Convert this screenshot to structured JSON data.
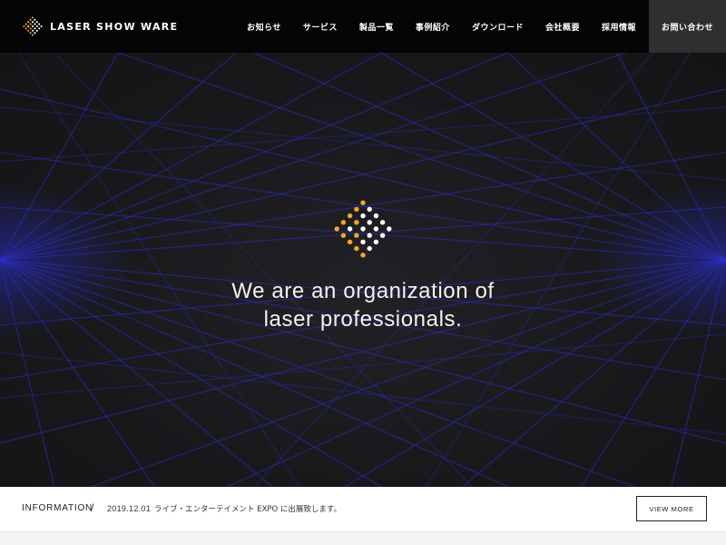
{
  "brand": {
    "name": "LASER SHOW WARE",
    "logo_icon": "diamond-dot-grid-icon",
    "accent_color": "#f5a623",
    "dot_color": "#ffffff"
  },
  "nav": {
    "items": [
      {
        "label": "お知らせ"
      },
      {
        "label": "サービス"
      },
      {
        "label": "製品一覧"
      },
      {
        "label": "事例紹介"
      },
      {
        "label": "ダウンロード"
      },
      {
        "label": "会社概要"
      },
      {
        "label": "採用情報"
      }
    ],
    "contact_label": "お問い合わせ",
    "contact_bg": "#2f2f2f"
  },
  "hero": {
    "line1": "We are an organization of",
    "line2": "laser professionals.",
    "laser_color": "#2b2fd0",
    "background": "#1a1a1c"
  },
  "info": {
    "title": "INFORMATION",
    "separator": "/",
    "date": "2019.12.01",
    "text": "ライブ・エンターテイメント EXPO に出展致します。",
    "button_label": "VIEW MORE"
  }
}
